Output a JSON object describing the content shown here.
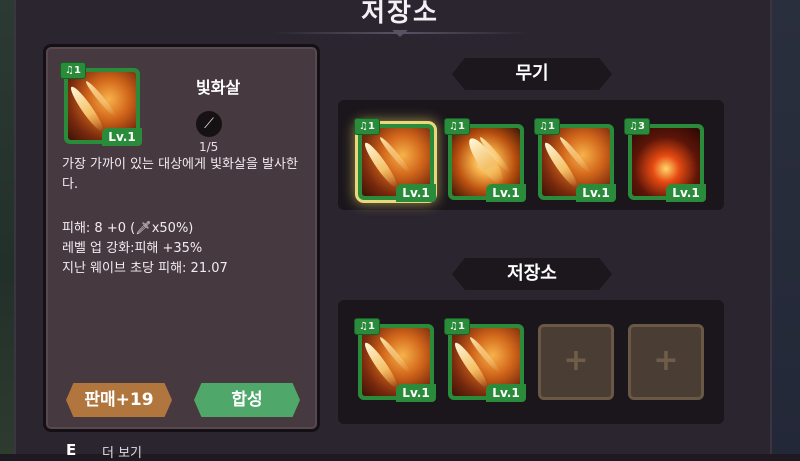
{
  "header": {
    "title": "저장소"
  },
  "detail": {
    "item_name": "빛화살",
    "item_level": "Lv.1",
    "item_badge": "♫1",
    "type_icon": "staff-icon",
    "type_count": "1/5",
    "description": "가장 가까이 있는 대상에게 빛화살을 발사한다.",
    "stats": [
      "피해: 8 +0 (🗡x50%)",
      "레벨 업 강화:피해 +35%",
      "지난 웨이브 초당 피해: 21.07"
    ],
    "sell_label": "판매+19",
    "merge_label": "합성"
  },
  "weapons": {
    "label": "무기",
    "slots": [
      {
        "badge": "♫1",
        "level": "Lv.1",
        "icon": "light-arrow-icon",
        "selected": true
      },
      {
        "badge": "♫1",
        "level": "Lv.1",
        "icon": "light-burst-icon",
        "selected": false
      },
      {
        "badge": "♫1",
        "level": "Lv.1",
        "icon": "light-arrow-icon",
        "selected": false
      },
      {
        "badge": "♫3",
        "level": "Lv.1",
        "icon": "fireball-icon",
        "selected": false
      }
    ]
  },
  "storage": {
    "label": "저장소",
    "slots": [
      {
        "badge": "♫1",
        "level": "Lv.1",
        "icon": "light-arrow-icon"
      },
      {
        "badge": "♫1",
        "level": "Lv.1",
        "icon": "light-arrow-icon"
      },
      {
        "empty": true,
        "icon": "plus-icon",
        "symbol": "+"
      },
      {
        "empty": true,
        "icon": "plus-icon",
        "symbol": "+"
      }
    ]
  },
  "footer": {
    "key": "E",
    "text": "더 보기"
  }
}
